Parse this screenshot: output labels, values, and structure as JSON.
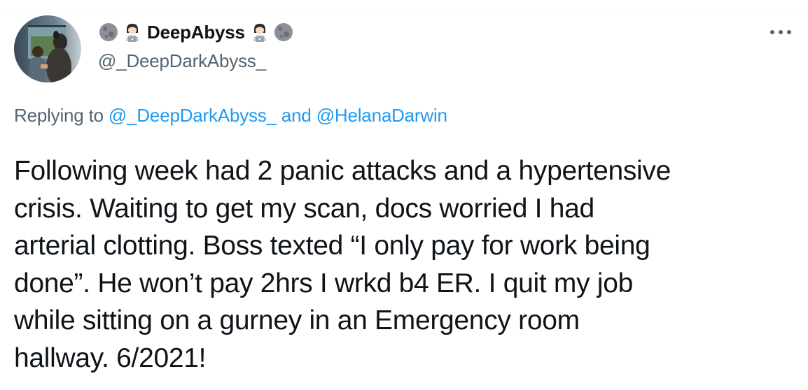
{
  "tweet": {
    "author": {
      "display_name": "DeepAbyss",
      "handle": "@_DeepDarkAbyss_",
      "name_decorations": [
        "moon-icon",
        "woman-technologist-icon",
        "woman-technologist-icon",
        "moon-icon"
      ]
    },
    "reply": {
      "prefix": "Replying to ",
      "mention_1": "@_DeepDarkAbyss_",
      "conjunction": " and ",
      "mention_2": "@HelanaDarwin"
    },
    "text_lines": [
      "Following week had 2 panic attacks and a hypertensive",
      "crisis. Waiting to get my scan, docs worried I had",
      "arterial clotting. Boss texted “I only pay for work being",
      "done”. He won’t pay 2hrs I wrkd b4 ER. I quit my job",
      "while sitting on a gurney in an Emergency room",
      "hallway. 6/2021!"
    ]
  },
  "colors": {
    "text_primary": "#0f1419",
    "text_secondary": "#536471",
    "accent": "#1d9bf0",
    "divider": "#eff3f4"
  }
}
